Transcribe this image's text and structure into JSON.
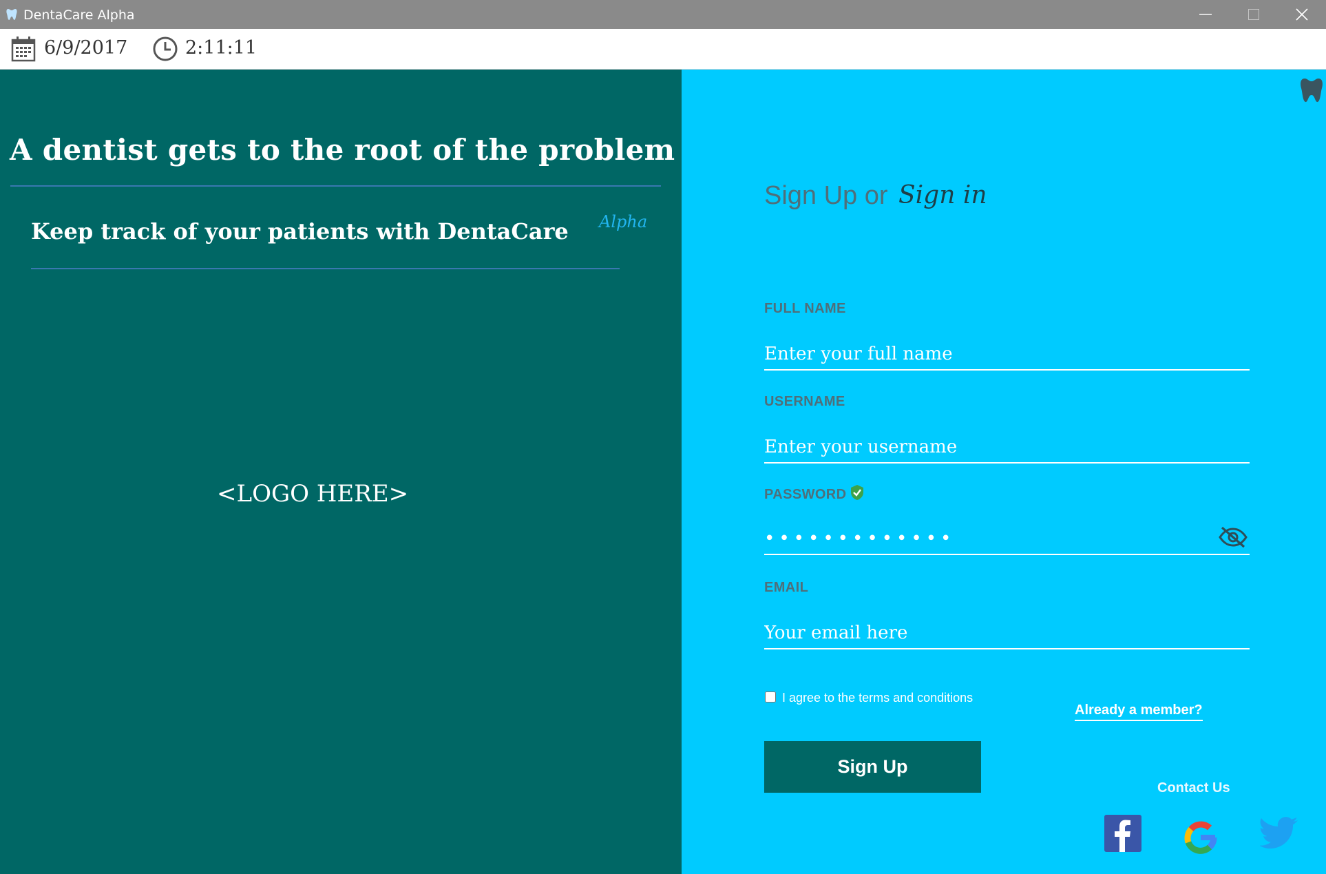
{
  "window": {
    "title": "DentaCare Alpha"
  },
  "toolbar": {
    "date": "6/9/2017",
    "time": "2:11:11"
  },
  "left": {
    "headline": "A dentist gets to the root of the problem",
    "subline": "Keep track of your patients with DentaCare",
    "alpha": "Alpha",
    "logo_placeholder": "<LOGO HERE>"
  },
  "form": {
    "title": "Sign Up or",
    "signin_link": "Sign in",
    "fullname": {
      "label": "FULL NAME",
      "placeholder": "Enter your full name",
      "value": ""
    },
    "username": {
      "label": "USERNAME",
      "placeholder": "Enter your username",
      "value": ""
    },
    "password": {
      "label": "PASSWORD",
      "value": "•••••••••••••"
    },
    "email": {
      "label": "EMAIL",
      "placeholder": "Your email here",
      "value": ""
    },
    "terms_label": "I agree to the terms and conditions",
    "terms_checked": false,
    "member_link": "Already a member?",
    "signup_button": "Sign Up",
    "contact_label": "Contact Us"
  },
  "colors": {
    "left_panel": "#006765",
    "right_panel": "#00cbff",
    "accent_alpha": "#22b5f0",
    "button": "#006765"
  },
  "icons": [
    "tooth-icon",
    "calendar-icon",
    "clock-icon",
    "shield-check-icon",
    "eye-slash-icon",
    "facebook-icon",
    "google-icon",
    "twitter-icon"
  ]
}
